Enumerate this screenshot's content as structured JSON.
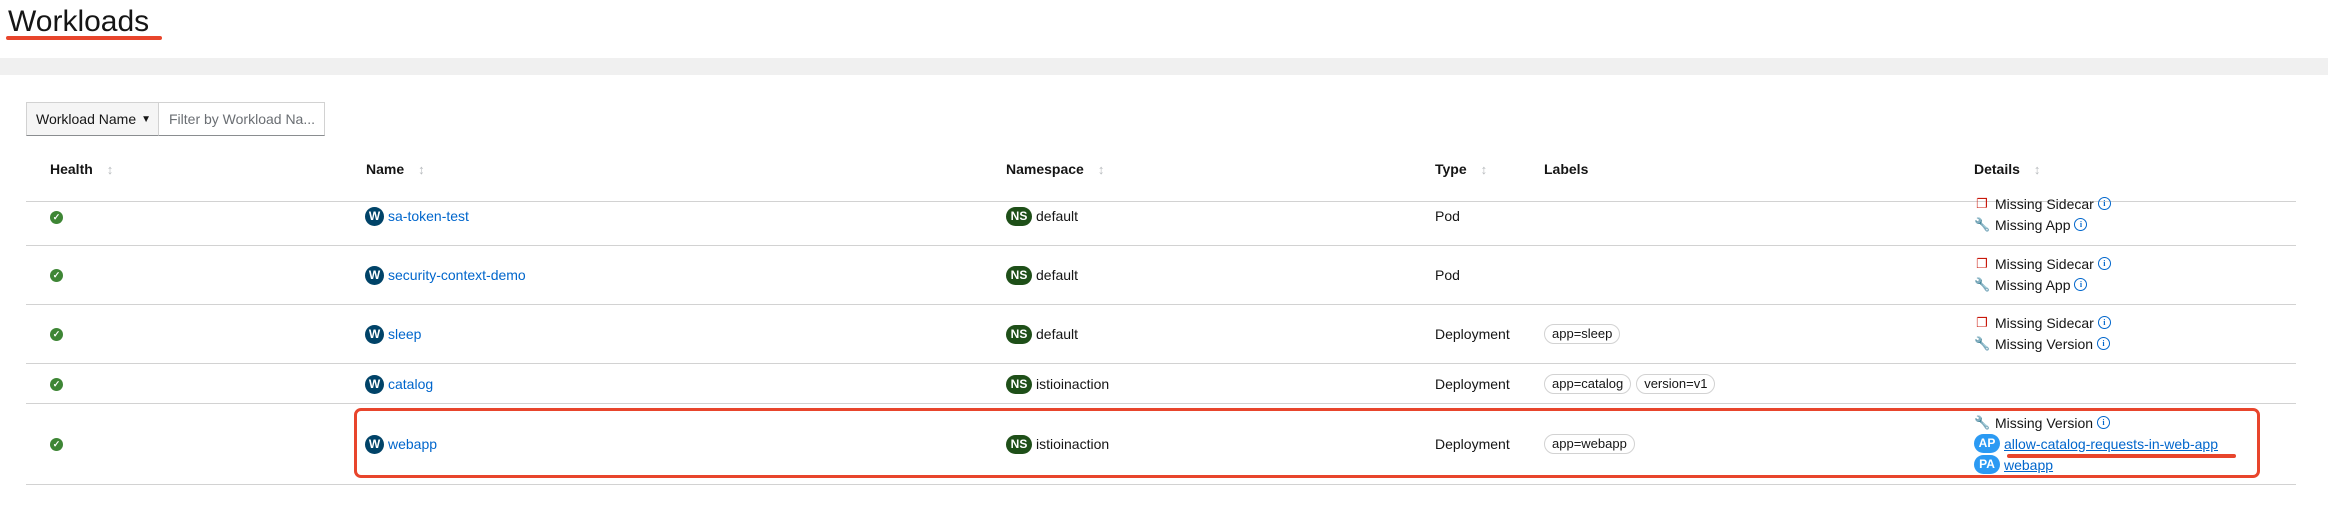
{
  "page": {
    "title": "Workloads"
  },
  "filter": {
    "select_label": "Workload Name",
    "placeholder": "Filter by Workload Na..."
  },
  "columns": {
    "health": "Health",
    "name": "Name",
    "namespace": "Namespace",
    "type": "Type",
    "labels": "Labels",
    "details": "Details"
  },
  "rows": [
    {
      "name": "sa-token-test",
      "namespace": "default",
      "type": "Pod",
      "labels": [],
      "details": [
        "Missing Sidecar",
        "Missing App"
      ]
    },
    {
      "name": "security-context-demo",
      "namespace": "default",
      "type": "Pod",
      "labels": [],
      "details": [
        "Missing Sidecar",
        "Missing App"
      ]
    },
    {
      "name": "sleep",
      "namespace": "default",
      "type": "Deployment",
      "labels": [
        "app=sleep"
      ],
      "details": [
        "Missing Sidecar",
        "Missing Version"
      ]
    },
    {
      "name": "catalog",
      "namespace": "istioinaction",
      "type": "Deployment",
      "labels": [
        "app=catalog",
        "version=v1"
      ],
      "details": []
    },
    {
      "name": "webapp",
      "namespace": "istioinaction",
      "type": "Deployment",
      "labels": [
        "app=webapp"
      ],
      "details": [
        "Missing Version"
      ],
      "links": [
        {
          "badge": "AP",
          "text": "allow-catalog-requests-in-web-app"
        },
        {
          "badge": "PA",
          "text": "webapp"
        }
      ]
    }
  ],
  "badges": {
    "workload": "W",
    "namespace": "NS"
  },
  "colors": {
    "accent": "#e8452c",
    "link": "#0066cc",
    "ok": "#3e8635"
  }
}
